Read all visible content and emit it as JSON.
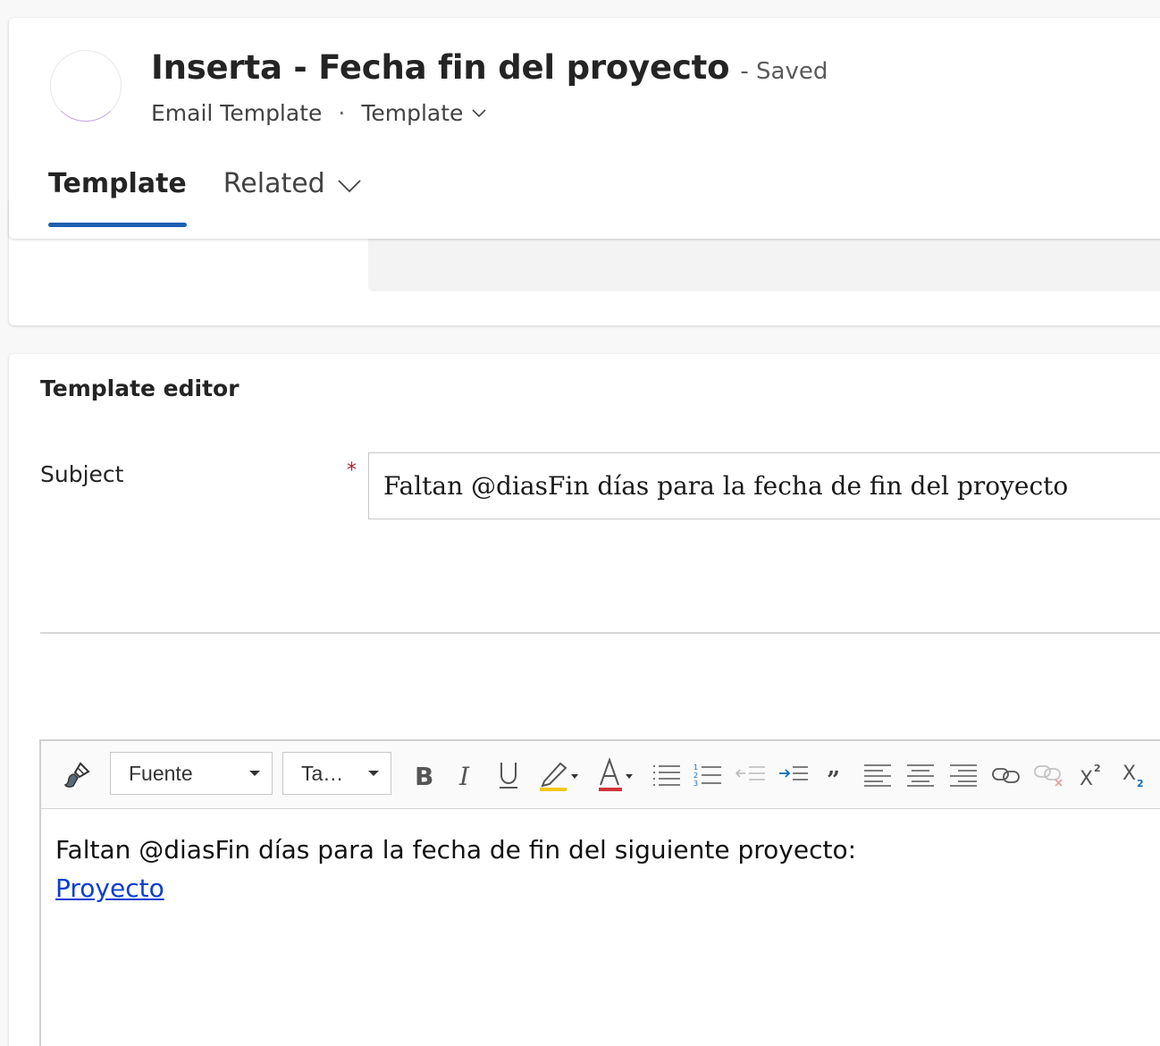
{
  "header": {
    "title": "Inserta - Fecha fin del proyecto",
    "save_status": "- Saved",
    "entity": "Email Template",
    "separator": "·",
    "form_selector": "Template"
  },
  "tabs": [
    {
      "label": "Template",
      "active": true
    },
    {
      "label": "Related",
      "has_dropdown": true
    }
  ],
  "editor": {
    "section_title": "Template editor",
    "subject": {
      "label": "Subject",
      "required_marker": "*",
      "value": "Faltan @diasFin días para la fecha de fin del proyecto"
    },
    "toolbar": {
      "font_combo": "Fuente",
      "size_combo": "Ta…",
      "buttons": [
        "format-painter",
        "bold",
        "italic",
        "underline",
        "highlight",
        "font-color",
        "bulleted-list",
        "numbered-list",
        "decrease-indent",
        "increase-indent",
        "blockquote",
        "align-left",
        "align-center",
        "align-right",
        "link",
        "unlink",
        "superscript",
        "subscript"
      ]
    },
    "body": {
      "line1": "Faltan @diasFin días para la fecha de fin del siguiente proyecto:",
      "link_text": "Proyecto"
    }
  },
  "colors": {
    "accent": "#1f5fb1",
    "required": "#a4262c",
    "link": "#0b3fd0",
    "highlight_bar": "#f2c811",
    "font_color_bar": "#d13438",
    "increase_indent_arrow": "#0f6cbd"
  }
}
